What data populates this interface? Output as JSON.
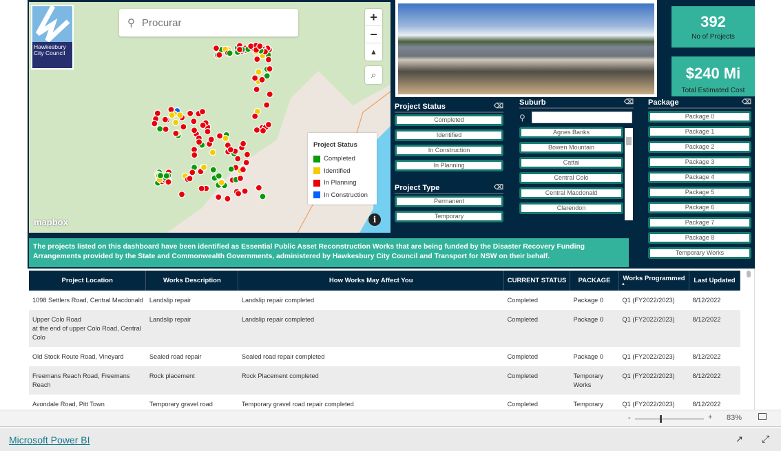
{
  "map": {
    "logo_text": [
      "Hawkesbury",
      "City Council"
    ],
    "search_placeholder": "Procurar",
    "zoom_in": "+",
    "zoom_out": "−",
    "compass": "▲",
    "locate": "⌕",
    "attribution": "mapbox",
    "info": "i",
    "legend": {
      "title": "Project Status",
      "items": [
        {
          "label": "Completed",
          "color": "#0a9a0a"
        },
        {
          "label": "Identified",
          "color": "#f5cc00"
        },
        {
          "label": "In Planning",
          "color": "#e8000b"
        },
        {
          "label": "In Construction",
          "color": "#0062ff"
        }
      ]
    }
  },
  "kpis": [
    {
      "value": "392",
      "label": "No of Projects"
    },
    {
      "value": "$240 Mi",
      "label": "Total Estimated Cost"
    }
  ],
  "slicers": {
    "status": {
      "title": "Project Status",
      "items": [
        "Completed",
        "Identified",
        "In Construction",
        "In Planning"
      ]
    },
    "type": {
      "title": "Project Type",
      "items": [
        "Permanent",
        "Temporary"
      ]
    },
    "suburb": {
      "title": "Suburb",
      "search_value": "",
      "items": [
        "Agnes Banks",
        "Bowen Mountain",
        "Cattai",
        "Central Colo",
        "Central Macdonald",
        "Clarendon"
      ]
    },
    "package": {
      "title": "Package",
      "items": [
        "Package 0",
        "Package 1",
        "Package 2",
        "Package 3",
        "Package 4",
        "Package 5",
        "Package 6",
        "Package 7",
        "Package 8",
        "Temporary Works"
      ]
    }
  },
  "banner": "The projects listed on this dashboard have been identified as Essential Public Asset Reconstruction Works that are being funded by the Disaster Recovery Funding Arrangements provided by the State and Commonwealth Governments, administered by Hawkesbury City Council and Transport for NSW on their behalf.",
  "table": {
    "columns": [
      "Project Location",
      "Works Description",
      "How Works May Affect You",
      "CURRENT STATUS",
      "PACKAGE",
      "Works Programmed",
      "Last Updated"
    ],
    "sort_indicator": "▲",
    "rows": [
      [
        "1098 Settlers Road, Central Macdonald",
        "Landslip repair",
        "Landslip repair completed",
        "Completed",
        "Package 0",
        "Q1 (FY2022/2023)",
        "8/12/2022"
      ],
      [
        "Upper Colo Road\nat the end of upper Colo Road, Central Colo",
        "Landslip repair",
        "Landslip repair completed",
        "Completed",
        "Package 0",
        "Q1 (FY2022/2023)",
        "8/12/2022"
      ],
      [
        "Old Stock Route Road, Vineyard",
        "Sealed road repair",
        "Sealed road repair completed",
        "Completed",
        "Package 0",
        "Q1 (FY2022/2023)",
        "8/12/2022"
      ],
      [
        "Freemans Reach Road, Freemans Reach",
        "Rock placement",
        "Rock Placement completed",
        "Completed",
        "Temporary Works",
        "Q1 (FY2022/2023)",
        "8/12/2022"
      ],
      [
        "Avondale Road, Pitt Town",
        "Temporary gravel road",
        "Temporary gravel road repair completed",
        "Completed",
        "Temporary",
        "Q1 (FY2022/2023)",
        "8/12/2022"
      ]
    ]
  },
  "zoom": {
    "minus": "-",
    "plus": "+",
    "level": "83%",
    "value_percent": 83
  },
  "footer": {
    "link": "Microsoft Power BI"
  }
}
